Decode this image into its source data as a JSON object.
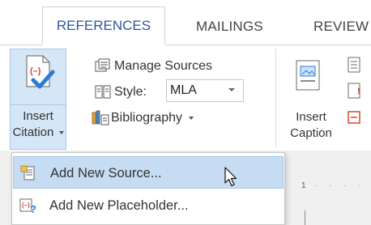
{
  "tabs": {
    "references": "REFERENCES",
    "mailings": "MAILINGS",
    "review": "REVIEW"
  },
  "ribbon": {
    "insert_citation": {
      "line1": "Insert",
      "line2": "Citation",
      "icon": "insert-citation-icon"
    },
    "manage_sources": "Manage Sources",
    "style_label": "Style:",
    "style_value": "MLA",
    "bibliography": "Bibliography",
    "insert_caption": {
      "line1": "Insert",
      "line2": "Caption"
    }
  },
  "menu": {
    "items": [
      {
        "label": "Add New Source...",
        "icon": "add-source-icon"
      },
      {
        "label": "Add New Placeholder...",
        "icon": "placeholder-icon"
      }
    ]
  },
  "ruler": {
    "marker": "1"
  },
  "colors": {
    "tab_active": "#2b579a",
    "pressed_bg": "#d5e6f7",
    "menu_highlight": "#c5dcf3",
    "citation_red": "#d04a2e",
    "check_blue": "#2b7cd3"
  }
}
